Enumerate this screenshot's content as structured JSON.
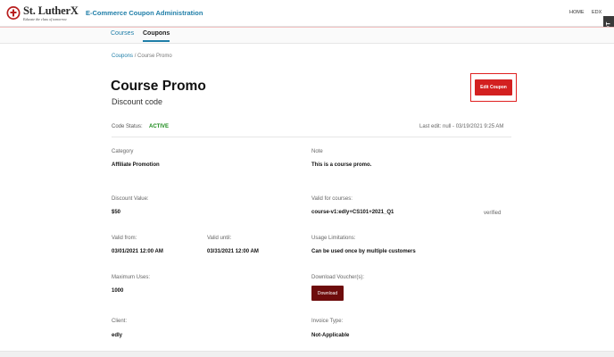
{
  "header": {
    "logo_name": "St. LutherX",
    "logo_tagline": "Educate the class of tomorrow",
    "app_title": "E-Commerce Coupon Administration",
    "nav_home": "HOME",
    "nav_edx": "EDX",
    "side_tab": "DDT"
  },
  "subnav": {
    "courses": "Courses",
    "coupons": "Coupons"
  },
  "breadcrumb": {
    "parent": "Coupons",
    "separator": "/",
    "current": "Course Promo"
  },
  "coupon": {
    "title": "Course Promo",
    "subtitle": "Discount code",
    "edit_label": "Edit Coupon",
    "status_label": "Code Status:",
    "status_value": "ACTIVE",
    "last_edit": "Last edit: null - 03/19/2021 9:25 AM"
  },
  "fields": {
    "category_label": "Category",
    "category_value": "Affiliate Promotion",
    "note_label": "Note",
    "note_value": "This is a course promo.",
    "discount_label": "Discount Value:",
    "discount_value": "$50",
    "courses_label": "Valid for courses:",
    "courses_value": "course-v1:edly+CS101+2021_Q1",
    "courses_status": "verified",
    "valid_from_label": "Valid from:",
    "valid_from_value": "03/01/2021 12:00 AM",
    "valid_until_label": "Valid until:",
    "valid_until_value": "03/31/2021 12:00 AM",
    "usage_label": "Usage Limitations:",
    "usage_value": "Can be used once by multiple customers",
    "max_uses_label": "Maximum Uses:",
    "max_uses_value": "1000",
    "voucher_label": "Download Voucher(s):",
    "download_label": "Download",
    "client_label": "Client:",
    "client_value": "edly",
    "invoice_label": "Invoice Type:",
    "invoice_value": "Not-Applicable"
  },
  "colors": {
    "accent": "#1f7ea8",
    "edit_button": "#d32020",
    "download_button": "#6e0c0c",
    "status_active": "#1a8a1a"
  }
}
